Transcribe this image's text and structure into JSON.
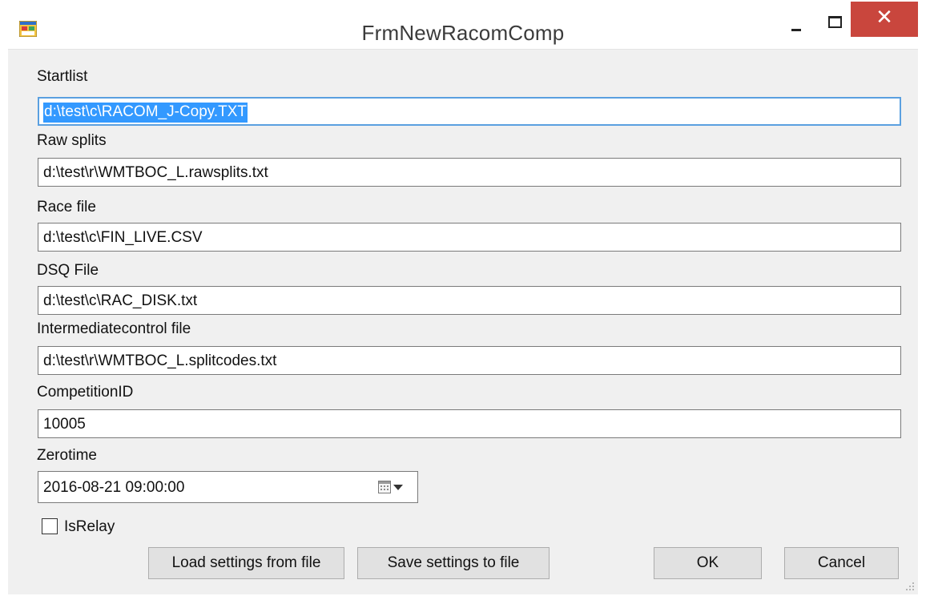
{
  "window": {
    "title": "FrmNewRacomComp"
  },
  "fields": {
    "startlist": {
      "label": "Startlist",
      "value": "d:\\test\\c\\RACOM_J-Copy.TXT"
    },
    "raw_splits": {
      "label": "Raw splits",
      "value": "d:\\test\\r\\WMTBOC_L.rawsplits.txt"
    },
    "race_file": {
      "label": "Race file",
      "value": "d:\\test\\c\\FIN_LIVE.CSV"
    },
    "dsq_file": {
      "label": "DSQ File",
      "value": "d:\\test\\c\\RAC_DISK.txt"
    },
    "intermediate": {
      "label": "Intermediatecontrol file",
      "value": "d:\\test\\r\\WMTBOC_L.splitcodes.txt"
    },
    "competition_id": {
      "label": "CompetitionID",
      "value": "10005"
    },
    "zerotime": {
      "label": "Zerotime",
      "value": "2016-08-21 09:00:00"
    }
  },
  "is_relay": {
    "label": "IsRelay",
    "checked": false
  },
  "buttons": {
    "load": "Load settings from file",
    "save": "Save settings to file",
    "ok": "OK",
    "cancel": "Cancel"
  },
  "icons": {
    "app": "winforms-app-icon",
    "calendar": "calendar-icon",
    "minimize": "minimize-icon",
    "maximize": "maximize-icon",
    "close": "close-icon"
  },
  "colors": {
    "close_button": "#c9463d",
    "focus_border": "#5aa0e0",
    "selection": "#3399ff",
    "dialog_background": "#f0f0f0"
  }
}
